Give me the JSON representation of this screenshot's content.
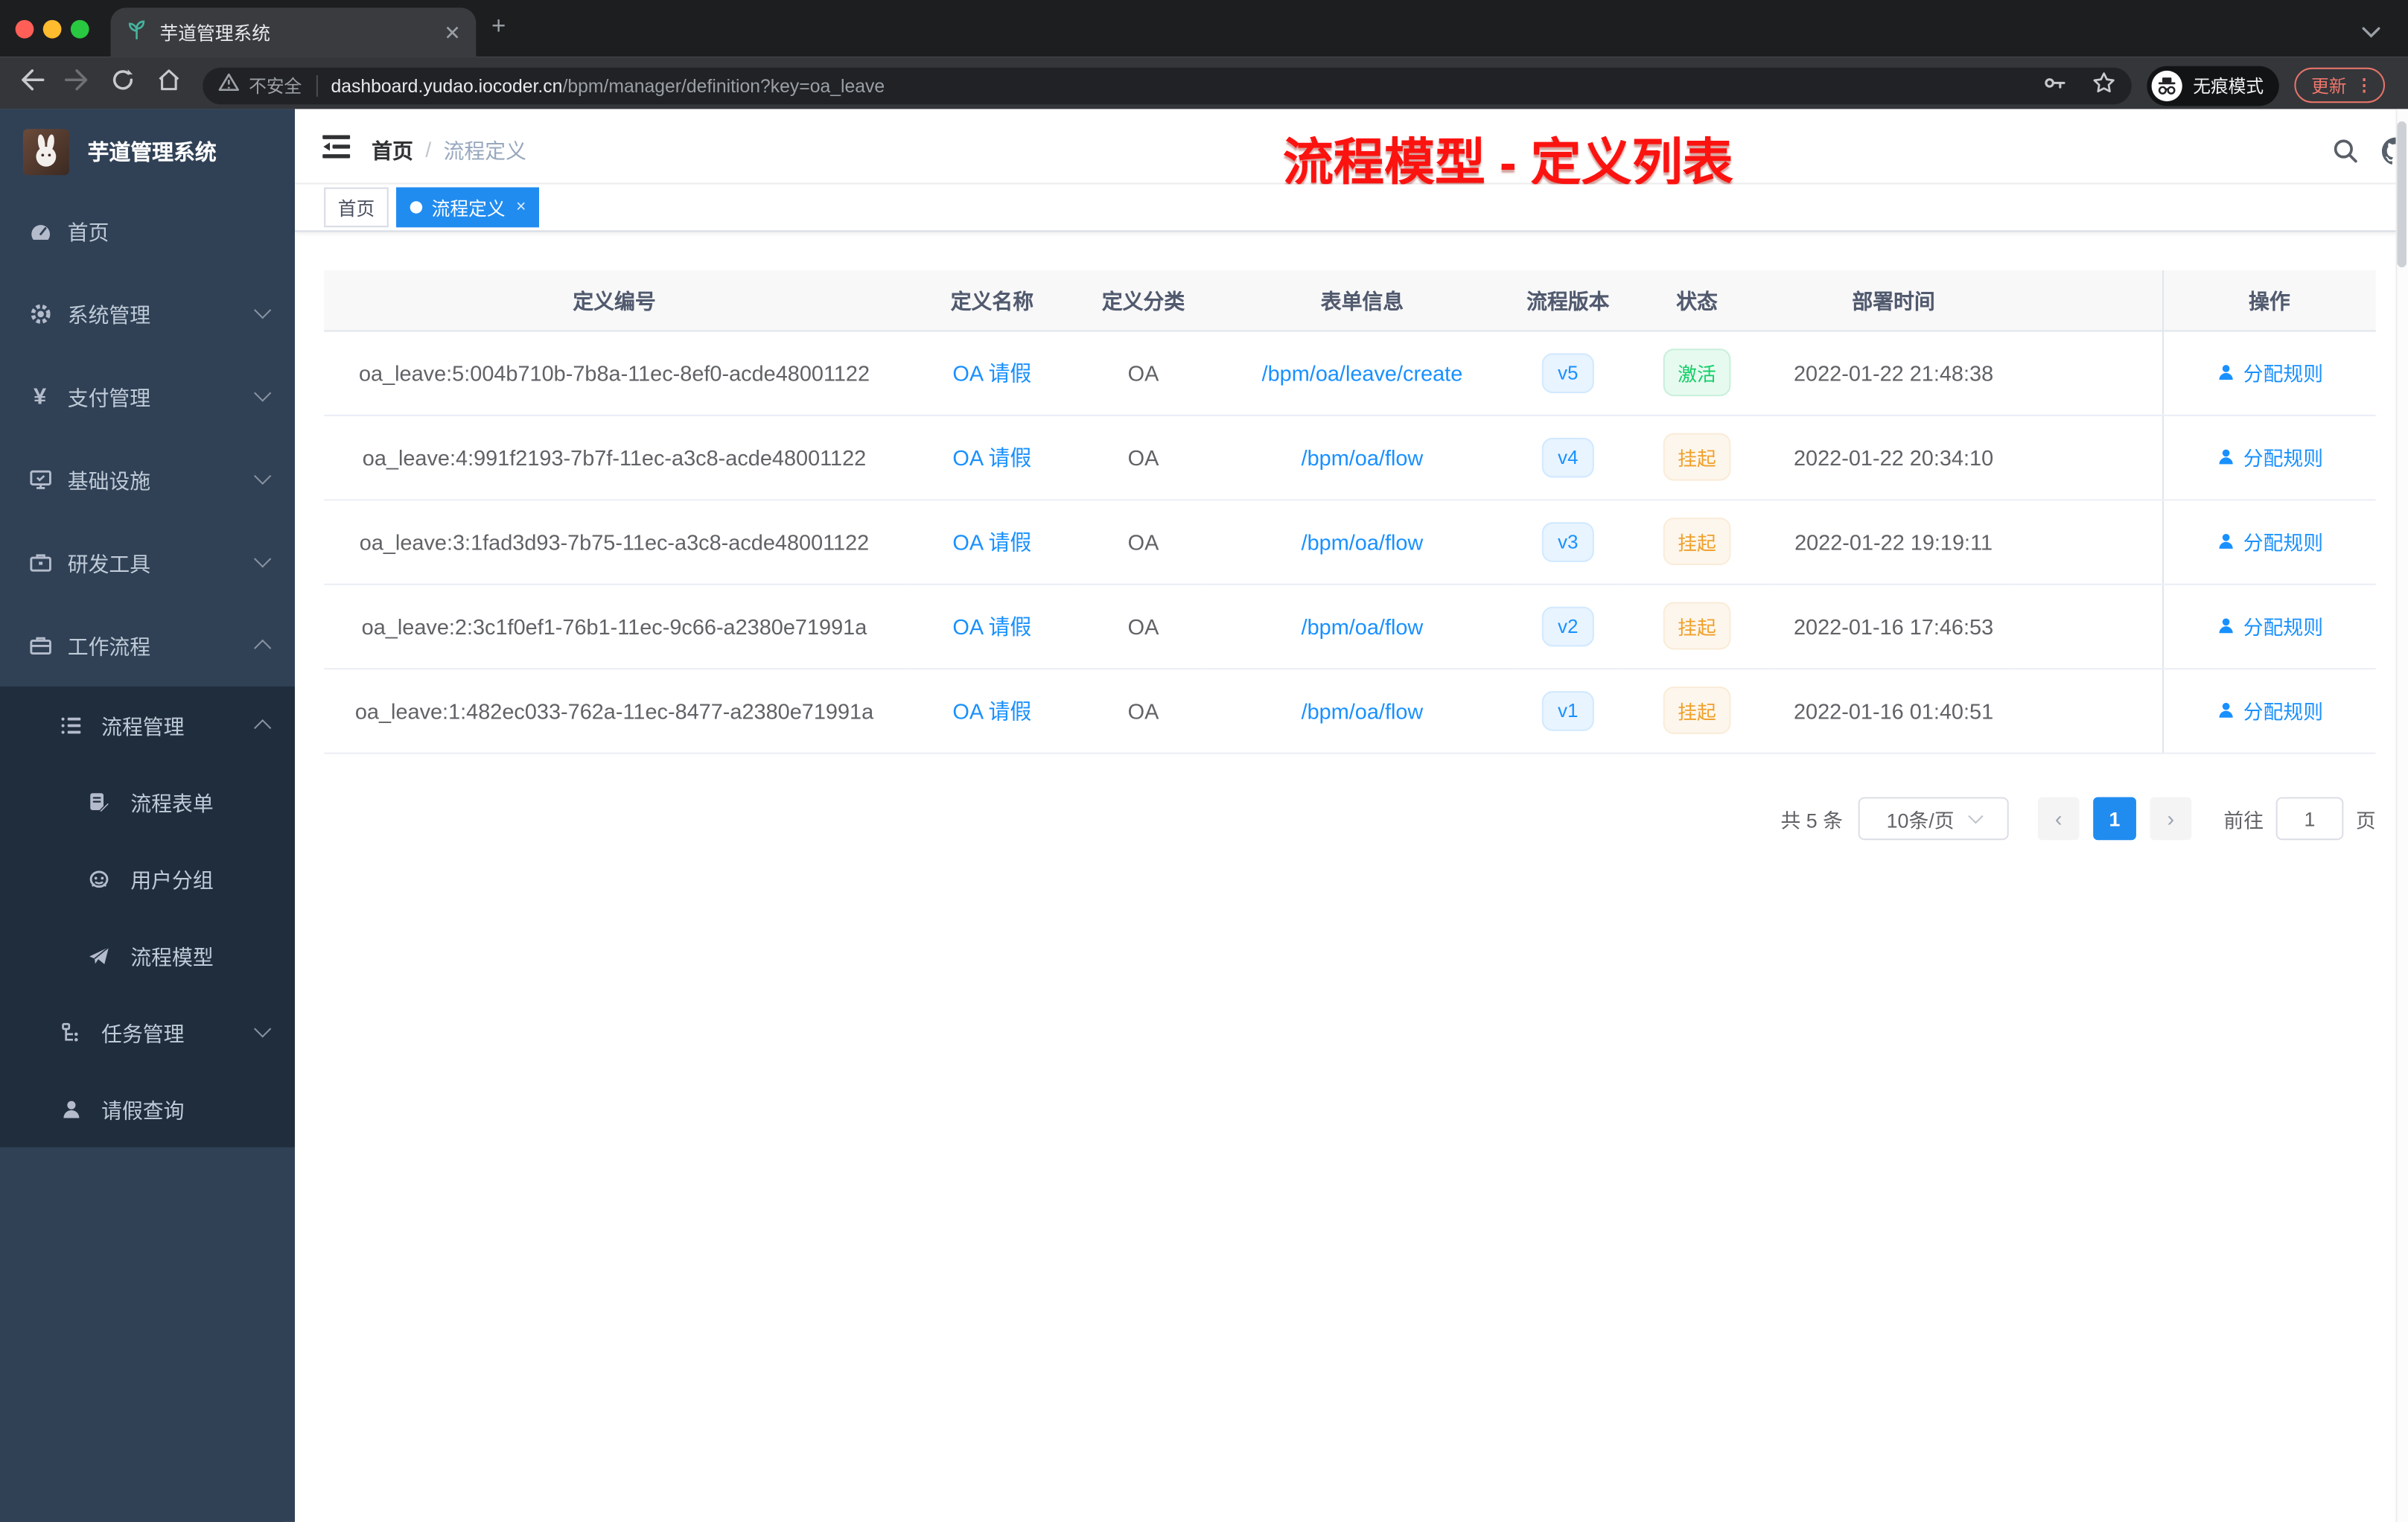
{
  "colors": {
    "accent": "#218cf0",
    "link": "#1890ff",
    "success": "#13ce66",
    "warning": "#efa02a",
    "sidebar_bg": "#304156",
    "submenu_bg": "#1f2d3d",
    "annotation_red": "#fb1310"
  },
  "browser": {
    "tab_title": "芋道管理系统",
    "new_tab": "+",
    "security_label": "不安全",
    "url_domain": "dashboard.yudao.iocoder.cn",
    "url_path": "/bpm/manager/definition?key=oa_leave",
    "incognito_label": "无痕模式",
    "update_label": "更新",
    "menu_dots": "⋮"
  },
  "sidebar": {
    "app_title": "芋道管理系统",
    "items": [
      {
        "label": "首页"
      },
      {
        "label": "系统管理"
      },
      {
        "label": "支付管理"
      },
      {
        "label": "基础设施"
      },
      {
        "label": "研发工具"
      },
      {
        "label": "工作流程"
      },
      {
        "label": "流程管理"
      },
      {
        "label": "流程表单"
      },
      {
        "label": "用户分组"
      },
      {
        "label": "流程模型"
      },
      {
        "label": "任务管理"
      },
      {
        "label": "请假查询"
      }
    ]
  },
  "header": {
    "breadcrumb_home": "首页",
    "breadcrumb_sep": "/",
    "breadcrumb_current": "流程定义",
    "annotation": "流程模型 - 定义列表"
  },
  "tags": {
    "home": "首页",
    "active": "流程定义",
    "close": "×"
  },
  "table": {
    "columns": [
      "定义编号",
      "定义名称",
      "定义分类",
      "表单信息",
      "流程版本",
      "状态",
      "部署时间",
      "操作"
    ],
    "rows": [
      {
        "id": "oa_leave:5:004b710b-7b8a-11ec-8ef0-acde48001122",
        "name": "OA 请假",
        "category": "OA",
        "form": "/bpm/oa/leave/create",
        "version": "v5",
        "status": "激活",
        "deployed": "2022-01-22 21:48:38",
        "action": "分配规则"
      },
      {
        "id": "oa_leave:4:991f2193-7b7f-11ec-a3c8-acde48001122",
        "name": "OA 请假",
        "category": "OA",
        "form": "/bpm/oa/flow",
        "version": "v4",
        "status": "挂起",
        "deployed": "2022-01-22 20:34:10",
        "action": "分配规则"
      },
      {
        "id": "oa_leave:3:1fad3d93-7b75-11ec-a3c8-acde48001122",
        "name": "OA 请假",
        "category": "OA",
        "form": "/bpm/oa/flow",
        "version": "v3",
        "status": "挂起",
        "deployed": "2022-01-22 19:19:11",
        "action": "分配规则"
      },
      {
        "id": "oa_leave:2:3c1f0ef1-76b1-11ec-9c66-a2380e71991a",
        "name": "OA 请假",
        "category": "OA",
        "form": "/bpm/oa/flow",
        "version": "v2",
        "status": "挂起",
        "deployed": "2022-01-16 17:46:53",
        "action": "分配规则"
      },
      {
        "id": "oa_leave:1:482ec033-762a-11ec-8477-a2380e71991a",
        "name": "OA 请假",
        "category": "OA",
        "form": "/bpm/oa/flow",
        "version": "v1",
        "status": "挂起",
        "deployed": "2022-01-16 01:40:51",
        "action": "分配规则"
      }
    ]
  },
  "pagination": {
    "total": "共 5 条",
    "page_size": "10条/页",
    "prev": "‹",
    "current_page": "1",
    "next": "›",
    "goto_label": "前往",
    "goto_value": "1",
    "unit": "页"
  }
}
